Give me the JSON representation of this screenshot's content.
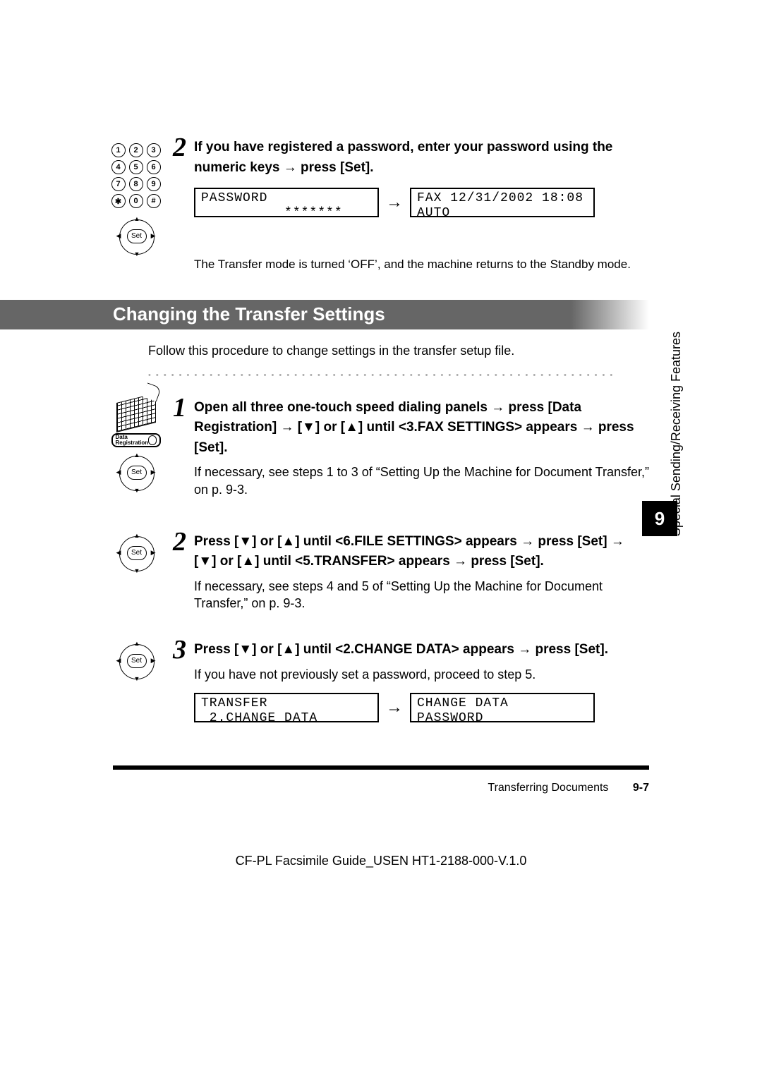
{
  "step2_top": {
    "num": "2",
    "head_parts": [
      "If you have registered a password, enter your password using the numeric keys ",
      "→",
      " press [Set]."
    ],
    "lcd_left": "PASSWORD\n          *******",
    "lcd_right": "FAX 12/31/2002 18:08\nAUTO",
    "note": "The Transfer mode is turned ‘OFF’, and the machine returns to the Standby mode."
  },
  "section_title": "Changing the Transfer Settings",
  "intro": "Follow this procedure to change settings in the transfer setup file.",
  "step1": {
    "num": "1",
    "head": "Open all three one-touch speed dialing panels → press [Data Registration] → [▼] or [▲] until <3.FAX SETTINGS> appears → press [Set].",
    "body": "If necessary, see steps 1 to 3 of “Setting Up the Machine for Document Transfer,” on p. 9-3."
  },
  "step2": {
    "num": "2",
    "head": "Press [▼] or [▲] until <6.FILE SETTINGS> appears → press [Set] → [▼] or [▲] until <5.TRANSFER> appears → press [Set].",
    "body": "If necessary, see steps 4 and 5 of “Setting Up the Machine for Document Transfer,” on p. 9-3."
  },
  "step3": {
    "num": "3",
    "head": "Press [▼] or [▲] until <2.CHANGE DATA> appears → press [Set].",
    "body": "If you have not previously set a password, proceed to step 5.",
    "lcd_left": "TRANSFER\n 2.CHANGE DATA",
    "lcd_right": "CHANGE DATA\nPASSWORD"
  },
  "sidebar": {
    "chapter_number": "9",
    "chapter_title": "Special Sending/Receiving Features"
  },
  "footer": {
    "section": "Transferring Documents",
    "page": "9-7"
  },
  "doc_id": "CF-PL Facsimile Guide_USEN HT1-2188-000-V.1.0",
  "keypad": [
    [
      "1",
      "2",
      "3"
    ],
    [
      "4",
      "5",
      "6"
    ],
    [
      "7",
      "8",
      "9"
    ],
    [
      "✱",
      "0",
      "#"
    ]
  ],
  "dpad_label": "Set",
  "data_reg_label": "Data\nRegistration"
}
